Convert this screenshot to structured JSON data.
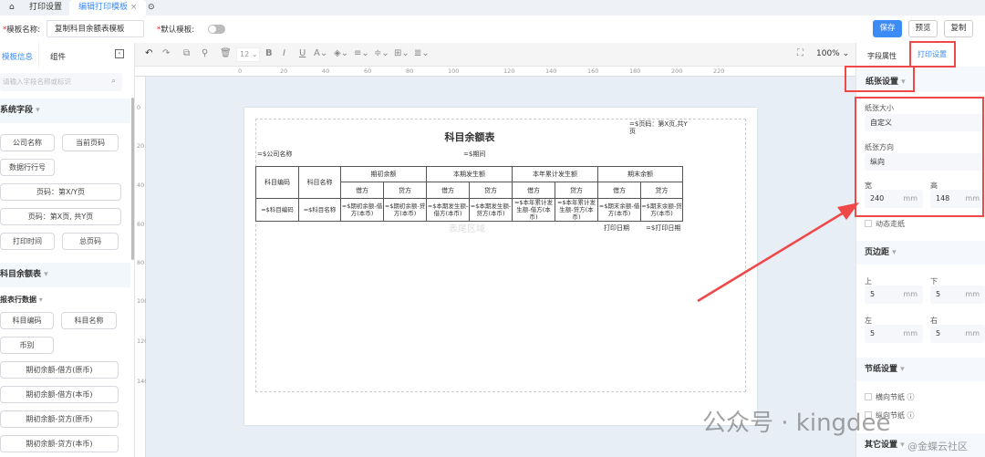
{
  "tabs": {
    "home": "⌂",
    "print_settings": "打印设置",
    "edit_template": "编辑打印模板",
    "close": "×",
    "more": "⊙"
  },
  "header": {
    "template_name_label": "模板名称:",
    "template_name_value": "复制科目余额表模板",
    "default_label": "默认模板:",
    "save": "保存",
    "preview": "预览",
    "copy": "复制",
    "star": "*"
  },
  "left": {
    "tab_info": "模板信息",
    "tab_components": "组件",
    "search_placeholder": "请输入字段名称或标识",
    "system_fields": "系统字段",
    "system_buttons": [
      "公司名称",
      "当前页码",
      "数据行行号",
      "页码：第X/Y页",
      "页码：第X页, 共Y页",
      "打印时间",
      "总页码"
    ],
    "report_section": "科目余额表",
    "row_data": "报表行数据",
    "row_buttons": [
      "科目编码",
      "科目名称",
      "币别",
      "期初余额-借方(原币)",
      "期初余额-借方(本币)",
      "期初余额-贷方(原币)",
      "期初余额-贷方(本币)"
    ]
  },
  "toolbar": {
    "font_size": "12",
    "zoom": "100%"
  },
  "ruler": {
    "h": [
      "0",
      "20",
      "40",
      "60",
      "80",
      "100",
      "120",
      "140",
      "160",
      "180",
      "200",
      "220"
    ],
    "v": [
      "0",
      "20",
      "40",
      "60",
      "80",
      "100",
      "120",
      "140"
    ]
  },
  "report": {
    "title": "科目余额表",
    "page_expr": "=$页码：第X页,共Y页",
    "company": "=$公司名称",
    "period": "=$期间",
    "h_code": "科目编码",
    "h_name": "科目名称",
    "groups": [
      "期初余额",
      "本期发生额",
      "本年累计发生额",
      "期末余额"
    ],
    "debit": "借方",
    "credit": "贷方",
    "cells": [
      "=$科目编码",
      "=$科目名称",
      "=$期初余额-借方(本币)",
      "=$期初余额-贷方(本币)",
      "=$本期发生额-借方(本币)",
      "=$本期发生额-贷方(本币)",
      "=$本年累计发生额-借方(本币)",
      "=$本年累计发生额-贷方(本币)",
      "=$期末余额-借方(本币)",
      "=$期末余额-贷方(本币)"
    ],
    "footer_area": "表尾区域",
    "print_date_label": "打印日期",
    "print_date_expr": "=$打印日期"
  },
  "right": {
    "tab_field": "字段属性",
    "tab_print": "打印设置",
    "paper": "纸张设置",
    "paper_size_label": "纸张大小",
    "paper_size": "自定义",
    "orientation_label": "纸张方向",
    "orientation": "纵向",
    "width_label": "宽",
    "width": "240",
    "height_label": "高",
    "height": "148",
    "unit": "mm",
    "dynamic": "动态走纸",
    "margin": "页边距",
    "top_label": "上",
    "top": "5",
    "bottom_label": "下",
    "bottom": "5",
    "left_label": "左",
    "left": "5",
    "right_label": "右",
    "right": "5",
    "save_paper": "节纸设置",
    "horizontal": "横向节纸",
    "vertical": "纵向节纸",
    "other": "其它设置"
  },
  "watermark": {
    "main": "公众号 · kingdee",
    "sub": "@金蝶云社区"
  }
}
